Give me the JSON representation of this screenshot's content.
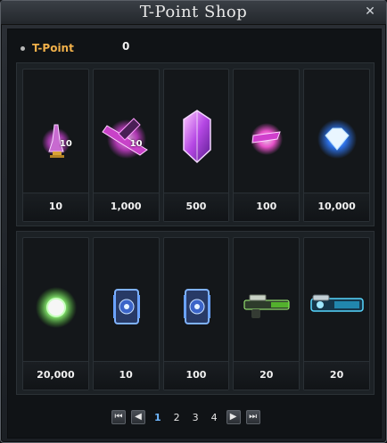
{
  "window": {
    "title": "T-Point Shop"
  },
  "balance": {
    "label": "T-Point",
    "value": "0"
  },
  "items_top": [
    {
      "price": "10",
      "qty": "10",
      "icon": "potion-icon"
    },
    {
      "price": "1,000",
      "qty": "10",
      "icon": "pink-crystal-icon"
    },
    {
      "price": "500",
      "qty": "",
      "icon": "purple-gem-icon"
    },
    {
      "price": "100",
      "qty": "",
      "icon": "pink-orb-icon"
    },
    {
      "price": "10,000",
      "qty": "",
      "icon": "blue-gem-icon"
    }
  ],
  "items_bottom": [
    {
      "price": "20,000",
      "qty": "",
      "icon": "white-green-orb-icon"
    },
    {
      "price": "10",
      "qty": "",
      "icon": "blue-plate-icon"
    },
    {
      "price": "100",
      "qty": "",
      "icon": "blue-plate-icon"
    },
    {
      "price": "20",
      "qty": "",
      "icon": "green-gun-icon"
    },
    {
      "price": "20",
      "qty": "",
      "icon": "blue-gun-icon"
    }
  ],
  "pagination": {
    "pages": [
      "1",
      "2",
      "3",
      "4"
    ],
    "current": "1"
  }
}
